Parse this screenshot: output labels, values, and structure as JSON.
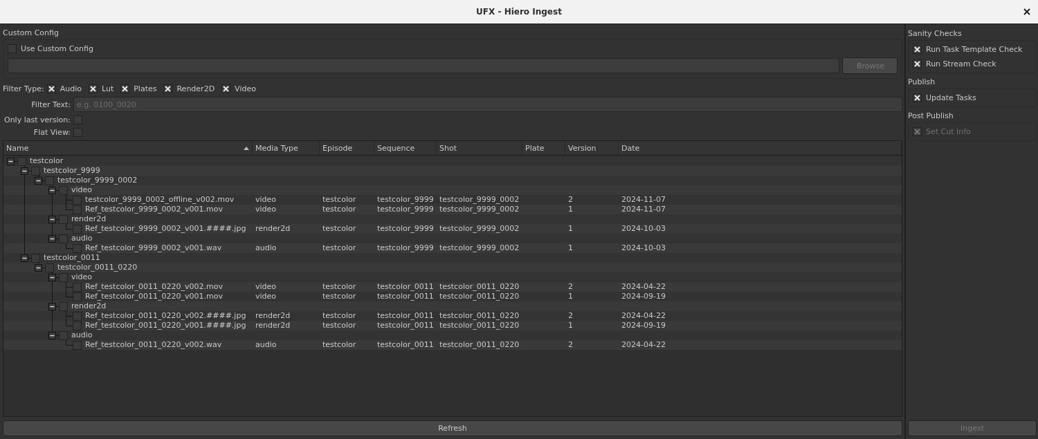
{
  "window": {
    "title": "UFX - Hiero Ingest"
  },
  "custom_config": {
    "title": "Custom Config",
    "use_custom_config": {
      "label": "Use Custom Config",
      "checked": false
    },
    "browse_button": {
      "label": "Browse",
      "disabled": true
    }
  },
  "filter_type": {
    "label": "Filter Type:",
    "options": [
      {
        "label": "Audio",
        "checked": true
      },
      {
        "label": "Lut",
        "checked": true
      },
      {
        "label": "Plates",
        "checked": true
      },
      {
        "label": "Render2D",
        "checked": true
      },
      {
        "label": "Video",
        "checked": true
      }
    ]
  },
  "filter_text": {
    "label": "Filter Text:",
    "placeholder": "e.g. 0100_0020"
  },
  "only_last_version": {
    "label": "Only last version:",
    "checked": false
  },
  "flat_view": {
    "label": "Flat View:",
    "checked": false
  },
  "table": {
    "columns": [
      {
        "label": "Name",
        "sorted": true
      },
      {
        "label": "Media Type",
        "sorted": false
      },
      {
        "label": "Episode",
        "sorted": false
      },
      {
        "label": "Sequence",
        "sorted": false
      },
      {
        "label": "Shot",
        "sorted": false
      },
      {
        "label": "Plate",
        "sorted": false
      },
      {
        "label": "Version",
        "sorted": false
      },
      {
        "label": "Date",
        "sorted": false
      }
    ],
    "rows": [
      {
        "name": "testcolor",
        "checked": false,
        "expanded": true,
        "children": [
          {
            "name": "testcolor_9999",
            "checked": false,
            "expanded": true,
            "children": [
              {
                "name": "testcolor_9999_0002",
                "checked": false,
                "expanded": true,
                "children": [
                  {
                    "name": "video",
                    "checked": false,
                    "expanded": true,
                    "children": [
                      {
                        "name": "testcolor_9999_0002_offline_v002.mov",
                        "checked": false,
                        "media_type": "video",
                        "episode": "testcolor",
                        "sequence": "testcolor_9999",
                        "shot": "testcolor_9999_0002",
                        "version": "2",
                        "date": "2024-11-07"
                      },
                      {
                        "name": "Ref_testcolor_9999_0002_v001.mov",
                        "checked": false,
                        "media_type": "video",
                        "episode": "testcolor",
                        "sequence": "testcolor_9999",
                        "shot": "testcolor_9999_0002",
                        "version": "1",
                        "date": "2024-11-07"
                      }
                    ]
                  },
                  {
                    "name": "render2d",
                    "checked": false,
                    "expanded": true,
                    "children": [
                      {
                        "name": "Ref_testcolor_9999_0002_v001.####.jpg",
                        "checked": false,
                        "media_type": "render2d",
                        "episode": "testcolor",
                        "sequence": "testcolor_9999",
                        "shot": "testcolor_9999_0002",
                        "version": "1",
                        "date": "2024-10-03"
                      }
                    ]
                  },
                  {
                    "name": "audio",
                    "checked": false,
                    "expanded": true,
                    "children": [
                      {
                        "name": "Ref_testcolor_9999_0002_v001.wav",
                        "checked": false,
                        "media_type": "audio",
                        "episode": "testcolor",
                        "sequence": "testcolor_9999",
                        "shot": "testcolor_9999_0002",
                        "version": "1",
                        "date": "2024-10-03"
                      }
                    ]
                  }
                ]
              }
            ]
          },
          {
            "name": "testcolor_0011",
            "checked": false,
            "expanded": true,
            "children": [
              {
                "name": "testcolor_0011_0220",
                "checked": false,
                "expanded": true,
                "children": [
                  {
                    "name": "video",
                    "checked": false,
                    "expanded": true,
                    "children": [
                      {
                        "name": "Ref_testcolor_0011_0220_v002.mov",
                        "checked": false,
                        "media_type": "video",
                        "episode": "testcolor",
                        "sequence": "testcolor_0011",
                        "shot": "testcolor_0011_0220",
                        "version": "2",
                        "date": "2024-04-22"
                      },
                      {
                        "name": "Ref_testcolor_0011_0220_v001.mov",
                        "checked": false,
                        "media_type": "video",
                        "episode": "testcolor",
                        "sequence": "testcolor_0011",
                        "shot": "testcolor_0011_0220",
                        "version": "1",
                        "date": "2024-09-19"
                      }
                    ]
                  },
                  {
                    "name": "render2d",
                    "checked": false,
                    "expanded": true,
                    "children": [
                      {
                        "name": "Ref_testcolor_0011_0220_v002.####.jpg",
                        "checked": false,
                        "media_type": "render2d",
                        "episode": "testcolor",
                        "sequence": "testcolor_0011",
                        "shot": "testcolor_0011_0220",
                        "version": "2",
                        "date": "2024-04-22"
                      },
                      {
                        "name": "Ref_testcolor_0011_0220_v001.####.jpg",
                        "checked": false,
                        "media_type": "render2d",
                        "episode": "testcolor",
                        "sequence": "testcolor_0011",
                        "shot": "testcolor_0011_0220",
                        "version": "1",
                        "date": "2024-09-19"
                      }
                    ]
                  },
                  {
                    "name": "audio",
                    "checked": false,
                    "expanded": true,
                    "children": [
                      {
                        "name": "Ref_testcolor_0011_0220_v002.wav",
                        "checked": false,
                        "media_type": "audio",
                        "episode": "testcolor",
                        "sequence": "testcolor_0011",
                        "shot": "testcolor_0011_0220",
                        "version": "2",
                        "date": "2024-04-22"
                      }
                    ]
                  }
                ]
              }
            ]
          }
        ]
      }
    ]
  },
  "refresh_button": {
    "label": "Refresh",
    "disabled": false
  },
  "side_panel": {
    "groups": [
      {
        "title": "Sanity Checks",
        "options": [
          {
            "label": "Run Task Template Check",
            "checked": true,
            "disabled": false
          },
          {
            "label": "Run Stream Check",
            "checked": true,
            "disabled": false
          }
        ]
      },
      {
        "title": "Publish",
        "options": [
          {
            "label": "Update Tasks",
            "checked": true,
            "disabled": false
          }
        ]
      },
      {
        "title": "Post Publish",
        "options": [
          {
            "label": "Set Cut Info",
            "checked": true,
            "disabled": true
          }
        ]
      }
    ]
  },
  "ingest_button": {
    "label": "Ingest",
    "disabled": true
  }
}
